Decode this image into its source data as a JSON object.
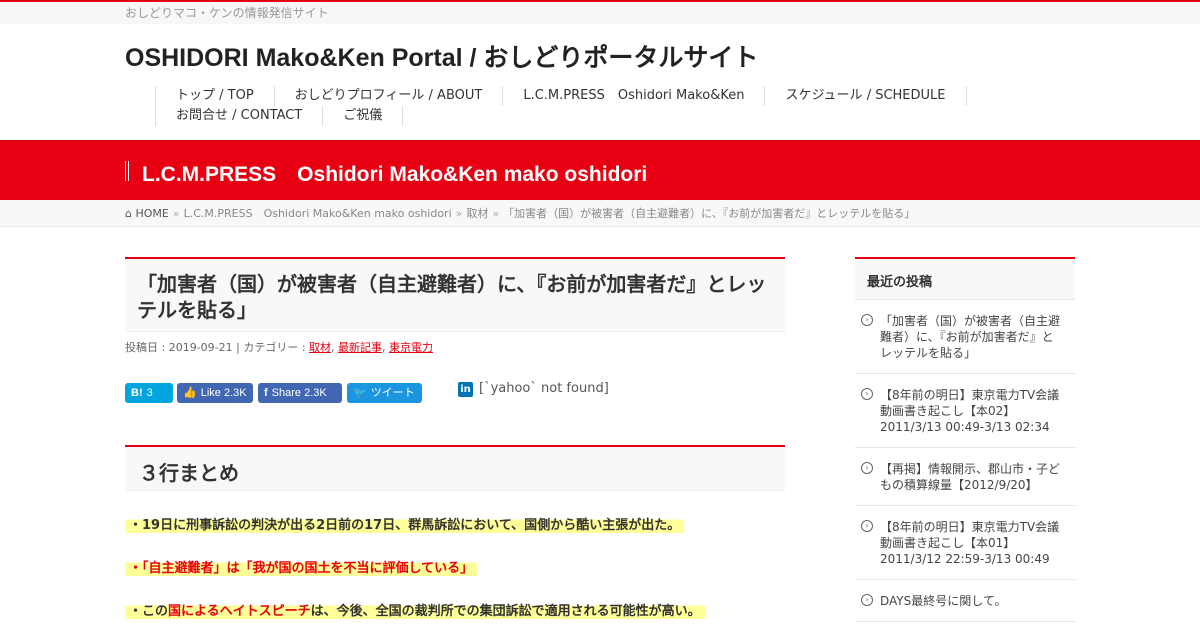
{
  "tagline": "おしどりマコ・ケンの情報発信サイト",
  "site_title": "OSHIDORI Mako&Ken Portal / おしどりポータルサイト",
  "nav": {
    "items": [
      "トップ / TOP",
      "おしどりプロフィール / ABOUT",
      "L.C.M.PRESS　Oshidori Mako&Ken",
      "スケジュール / SCHEDULE",
      "お問合せ / CONTACT",
      "ご祝儀"
    ]
  },
  "category_title": "L.C.M.PRESS　Oshidori Mako&Ken mako oshidori",
  "breadcrumb": {
    "home": "HOME",
    "sep": "»",
    "items": [
      "L.C.M.PRESS　Oshidori Mako&Ken mako oshidori",
      "取材",
      "「加害者（国）が被害者（自主避難者）に、『お前が加害者だ』とレッテルを貼る」"
    ]
  },
  "post": {
    "title": "「加害者（国）が被害者（自主避難者）に、『お前が加害者だ』とレッテルを貼る」",
    "date_label": "投稿日 : 2019-09-21",
    "category_label": "カテゴリー :",
    "categories": [
      "取材",
      "最新記事",
      "東京電力"
    ],
    "share": {
      "hatena_icon": "B!",
      "hatena_count": "3",
      "fb_like_label": "Like",
      "fb_like_count": "2.3K",
      "fb_share_label": "Share",
      "fb_share_count": "2.3K",
      "tweet_label": "ツイート",
      "linkedin_text": "[`yahoo` not found]"
    },
    "section_heading": "３行まとめ",
    "summary": {
      "line1": "・19日に刑事訴訟の判決が出る2日前の17日、群馬訴訟において、国側から酷い主張が出た。",
      "line2": "・「自主避難者」は「我が国の国土を不当に評価している」",
      "line3_pre": "・この",
      "line3_red": "国によるヘイトスピーチ",
      "line3_post": "は、今後、全国の裁判所での集団訴訟で適用される可能性が高い。"
    }
  },
  "sidebar": {
    "heading": "最近の投稿",
    "posts": [
      "「加害者（国）が被害者（自主避難者）に、『お前が加害者だ』とレッテルを貼る」",
      "【8年前の明日】東京電力TV会議動画書き起こし【本02】2011/3/13 00:49-3/13 02:34",
      "【再掲】情報開示、郡山市・子どもの積算線量【2012/9/20】",
      "【8年前の明日】東京電力TV会議動画書き起こし【本01】2011/3/12 22:59-3/13 00:49",
      "DAYS最終号に関して。"
    ]
  },
  "colors": {
    "accent": "#e60012",
    "highlight": "#ffff99"
  }
}
